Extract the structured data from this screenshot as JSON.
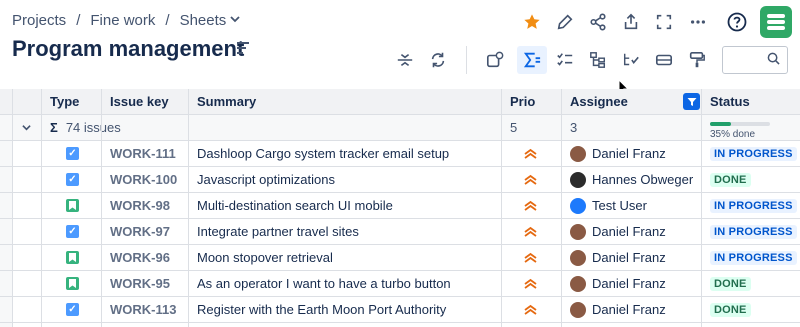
{
  "breadcrumbs": {
    "items": [
      "Projects",
      "Fine work",
      "Sheets"
    ],
    "separator": "/",
    "dropdown_icon": "chevron-down-icon"
  },
  "page": {
    "title": "Program management"
  },
  "top_icons": [
    "star-icon",
    "pencil-icon",
    "share-icon",
    "export-icon",
    "fullscreen-icon",
    "more-icon",
    "help-icon",
    "app-logo"
  ],
  "toolbar_icons": [
    "row-height-icon",
    "refresh-icon",
    "add-view-icon",
    "sum-icon",
    "checklist-icon",
    "hierarchy-icon",
    "filter-list-icon",
    "card-icon",
    "format-painter-icon"
  ],
  "search": {
    "placeholder": "",
    "icon": "search-icon"
  },
  "columns": [
    "Type",
    "Issue key",
    "Summary",
    "Prio",
    "Assignee",
    "Status"
  ],
  "summary_row": {
    "sigma": "Σ",
    "issues": "74 issues",
    "prio": "5",
    "assignee": "3",
    "status_progress": 0.35,
    "status_label": "35% done"
  },
  "rows": [
    {
      "type": "task",
      "key": "WORK-111",
      "summary": "Dashloop Cargo system tracker email setup",
      "prio": "high",
      "assignee": "Daniel Franz",
      "status": "IN PROGRESS"
    },
    {
      "type": "task",
      "key": "WORK-100",
      "summary": "Javascript optimizations",
      "prio": "high",
      "assignee": "Hannes Obweger",
      "status": "DONE"
    },
    {
      "type": "story",
      "key": "WORK-98",
      "summary": "Multi-destination search UI mobile",
      "prio": "high",
      "assignee": "Test User",
      "status": "IN PROGRESS"
    },
    {
      "type": "task",
      "key": "WORK-97",
      "summary": "Integrate partner travel sites",
      "prio": "high",
      "assignee": "Daniel Franz",
      "status": "IN PROGRESS"
    },
    {
      "type": "story",
      "key": "WORK-96",
      "summary": "Moon stopover retrieval",
      "prio": "high",
      "assignee": "Daniel Franz",
      "status": "IN PROGRESS"
    },
    {
      "type": "story",
      "key": "WORK-95",
      "summary": "As an operator I want to have a turbo button",
      "prio": "high",
      "assignee": "Daniel Franz",
      "status": "DONE"
    },
    {
      "type": "task",
      "key": "WORK-113",
      "summary": "Register with the Earth Moon Port Authority",
      "prio": "high",
      "assignee": "Daniel Franz",
      "status": "DONE"
    }
  ],
  "colors": {
    "accent": "#0c66e4",
    "done_bg": "#dcfff1",
    "in_progress_bg": "#e9f2ff",
    "priority": "#e56910",
    "logo": "#2fa866"
  }
}
